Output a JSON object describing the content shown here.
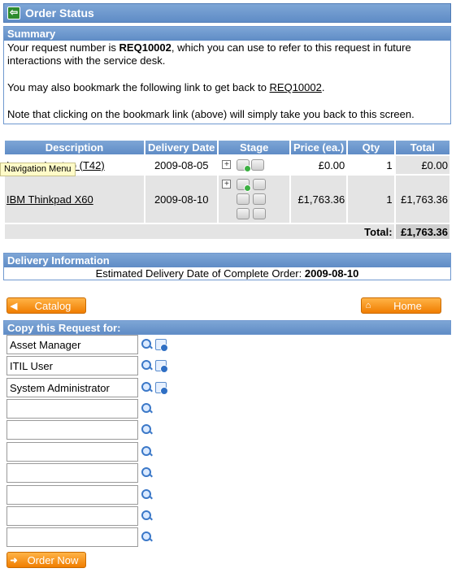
{
  "header": {
    "title": "Order Status",
    "back_icon": "back-arrow-icon"
  },
  "summary": {
    "heading": "Summary",
    "line1_pre": "Your request number is ",
    "request_number": "REQ10002",
    "line1_post": ", which you can use to refer to this request in future interactions with the service desk.",
    "line2_pre": "You may also bookmark the following link to get back to ",
    "bookmark_link": "REQ10002",
    "line2_post": ".",
    "line3": "Note that clicking on the bookmark link (above) will simply take you back to this screen."
  },
  "items_table": {
    "headers": [
      "Description",
      "Delivery Date",
      "Stage",
      "Price (ea.)",
      "Qty",
      "Total"
    ],
    "rows": [
      {
        "description": "Lenovo Laptop (T42)",
        "delivery_date": "2009-08-05",
        "price": "£0.00",
        "qty": "1",
        "total": "£0.00"
      },
      {
        "description": "IBM Thinkpad X60",
        "delivery_date": "2009-08-10",
        "price": "£1,763.36",
        "qty": "1",
        "total": "£1,763.36"
      }
    ],
    "total_label": "Total:",
    "total_value": "£1,763.36"
  },
  "tooltip": "Navigation Menu",
  "delivery": {
    "heading": "Delivery Information",
    "label": "Estimated Delivery Date of Complete Order: ",
    "date": "2009-08-10"
  },
  "buttons": {
    "catalog": "Catalog",
    "home": "Home",
    "order_now": "Order Now"
  },
  "copy": {
    "heading": "Copy this Request for:",
    "entries": [
      "Asset Manager",
      "ITIL User",
      "System Administrator",
      "",
      "",
      "",
      "",
      "",
      "",
      ""
    ]
  },
  "colors": {
    "header_blue": "#6f98cf",
    "button_orange": "#f07d00"
  }
}
